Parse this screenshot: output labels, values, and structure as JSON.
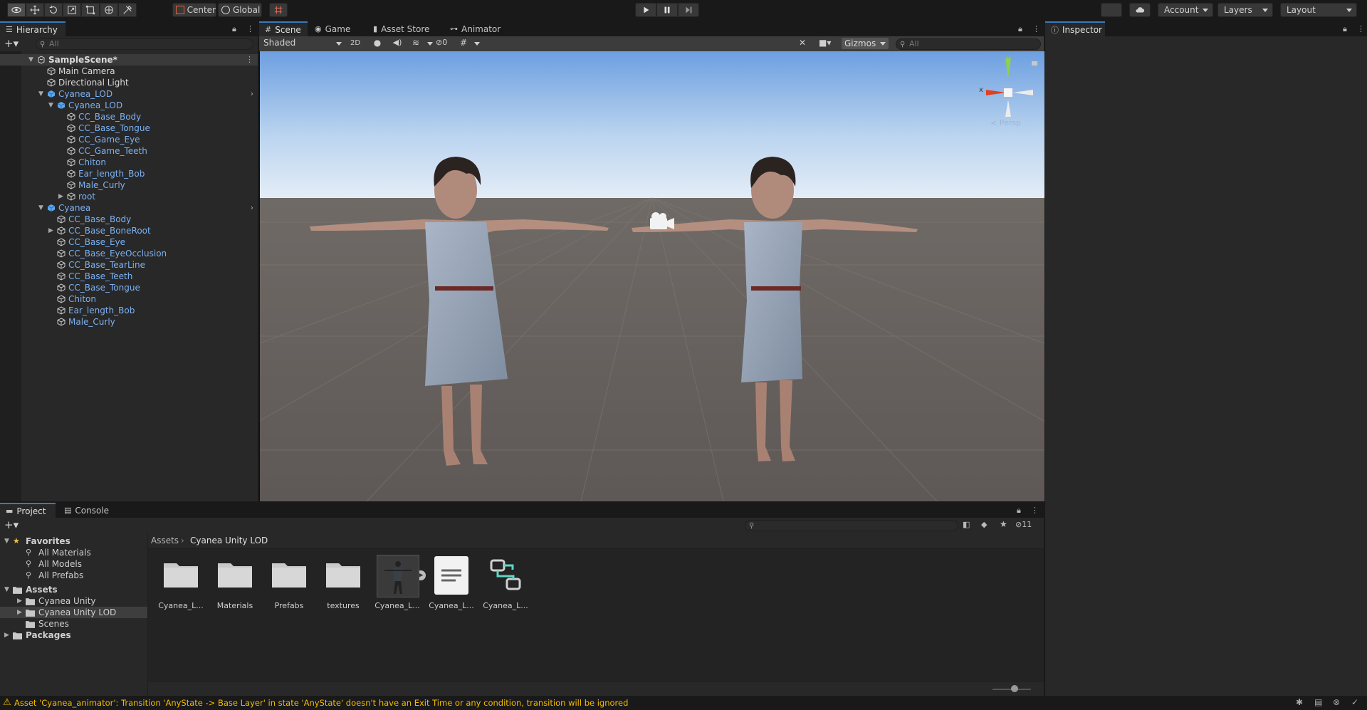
{
  "toolbar": {
    "pivot_center": "Center",
    "pivot_global": "Global",
    "account": "Account",
    "layers": "Layers",
    "layout": "Layout"
  },
  "hierarchy": {
    "tab": "Hierarchy",
    "search_placeholder": "All",
    "rows": [
      {
        "label": "SampleScene*",
        "indent": 0,
        "fold": "open",
        "kind": "scene",
        "color": "white"
      },
      {
        "label": "Main Camera",
        "indent": 1,
        "fold": "none",
        "kind": "object",
        "color": "white"
      },
      {
        "label": "Directional Light",
        "indent": 1,
        "fold": "none",
        "kind": "object",
        "color": "white"
      },
      {
        "label": "Cyanea_LOD",
        "indent": 1,
        "fold": "open",
        "kind": "prefab",
        "color": "blue",
        "arrow": true
      },
      {
        "label": "Cyanea_LOD",
        "indent": 2,
        "fold": "open",
        "kind": "prefab-lod",
        "color": "blue"
      },
      {
        "label": "CC_Base_Body",
        "indent": 3,
        "fold": "none",
        "kind": "object",
        "color": "blue"
      },
      {
        "label": "CC_Base_Tongue",
        "indent": 3,
        "fold": "none",
        "kind": "object",
        "color": "blue"
      },
      {
        "label": "CC_Game_Eye",
        "indent": 3,
        "fold": "none",
        "kind": "object",
        "color": "blue"
      },
      {
        "label": "CC_Game_Teeth",
        "indent": 3,
        "fold": "none",
        "kind": "object",
        "color": "blue"
      },
      {
        "label": "Chiton",
        "indent": 3,
        "fold": "none",
        "kind": "object",
        "color": "blue"
      },
      {
        "label": "Ear_length_Bob",
        "indent": 3,
        "fold": "none",
        "kind": "object",
        "color": "blue"
      },
      {
        "label": "Male_Curly",
        "indent": 3,
        "fold": "none",
        "kind": "object",
        "color": "blue"
      },
      {
        "label": "root",
        "indent": 3,
        "fold": "closed",
        "kind": "object",
        "color": "blue"
      },
      {
        "label": "Cyanea",
        "indent": 1,
        "fold": "open",
        "kind": "prefab",
        "color": "blue",
        "arrow": true
      },
      {
        "label": "CC_Base_Body",
        "indent": 2,
        "fold": "none",
        "kind": "object",
        "color": "blue"
      },
      {
        "label": "CC_Base_BoneRoot",
        "indent": 2,
        "fold": "closed",
        "kind": "object",
        "color": "blue"
      },
      {
        "label": "CC_Base_Eye",
        "indent": 2,
        "fold": "none",
        "kind": "object",
        "color": "blue"
      },
      {
        "label": "CC_Base_EyeOcclusion",
        "indent": 2,
        "fold": "none",
        "kind": "object",
        "color": "blue"
      },
      {
        "label": "CC_Base_TearLine",
        "indent": 2,
        "fold": "none",
        "kind": "object",
        "color": "blue"
      },
      {
        "label": "CC_Base_Teeth",
        "indent": 2,
        "fold": "none",
        "kind": "object",
        "color": "blue"
      },
      {
        "label": "CC_Base_Tongue",
        "indent": 2,
        "fold": "none",
        "kind": "object",
        "color": "blue"
      },
      {
        "label": "Chiton",
        "indent": 2,
        "fold": "none",
        "kind": "object",
        "color": "blue"
      },
      {
        "label": "Ear_length_Bob",
        "indent": 2,
        "fold": "none",
        "kind": "object",
        "color": "blue"
      },
      {
        "label": "Male_Curly",
        "indent": 2,
        "fold": "none",
        "kind": "object",
        "color": "blue"
      }
    ]
  },
  "scene": {
    "tabs": [
      "Scene",
      "Game",
      "Asset Store",
      "Animator"
    ],
    "shading": "Shaded",
    "mode_2d": "2D",
    "hidden_count": "0",
    "gizmos": "Gizmos",
    "search_placeholder": "All",
    "gizmo_y": "y",
    "gizmo_x": "x",
    "persp": "< Persp"
  },
  "inspector": {
    "tab": "Inspector"
  },
  "project": {
    "tabs": [
      "Project",
      "Console"
    ],
    "visible_count": "11",
    "breadcrumb": [
      "Assets",
      "Cyanea Unity LOD"
    ],
    "tree": [
      {
        "label": "Favorites",
        "bold": true,
        "fold": "open",
        "icon": "star",
        "indent": 0
      },
      {
        "label": "All Materials",
        "bold": false,
        "fold": "none",
        "icon": "search",
        "indent": 1
      },
      {
        "label": "All Models",
        "bold": false,
        "fold": "none",
        "icon": "search",
        "indent": 1
      },
      {
        "label": "All Prefabs",
        "bold": false,
        "fold": "none",
        "icon": "search",
        "indent": 1
      },
      {
        "label": "Assets",
        "bold": true,
        "fold": "open",
        "icon": "folder",
        "indent": 0
      },
      {
        "label": "Cyanea Unity",
        "bold": false,
        "fold": "closed",
        "icon": "folder",
        "indent": 1
      },
      {
        "label": "Cyanea Unity LOD",
        "bold": false,
        "fold": "closed",
        "icon": "folder",
        "indent": 1,
        "selected": true
      },
      {
        "label": "Scenes",
        "bold": false,
        "fold": "none",
        "icon": "folder",
        "indent": 1
      },
      {
        "label": "Packages",
        "bold": true,
        "fold": "closed",
        "icon": "folder",
        "indent": 0
      }
    ],
    "assets": [
      {
        "label": "Cyanea_L...",
        "type": "folder"
      },
      {
        "label": "Materials",
        "type": "folder"
      },
      {
        "label": "Prefabs",
        "type": "folder"
      },
      {
        "label": "textures",
        "type": "folder"
      },
      {
        "label": "Cyanea_L...",
        "type": "model"
      },
      {
        "label": "Cyanea_L...",
        "type": "text"
      },
      {
        "label": "Cyanea_L...",
        "type": "animator"
      }
    ]
  },
  "status": {
    "message": "Asset 'Cyanea_animator': Transition 'AnyState -> Base Layer' in state 'AnyState' doesn't have an Exit Time or any condition, transition will be ignored",
    "warning_color": "#f4bc02"
  }
}
